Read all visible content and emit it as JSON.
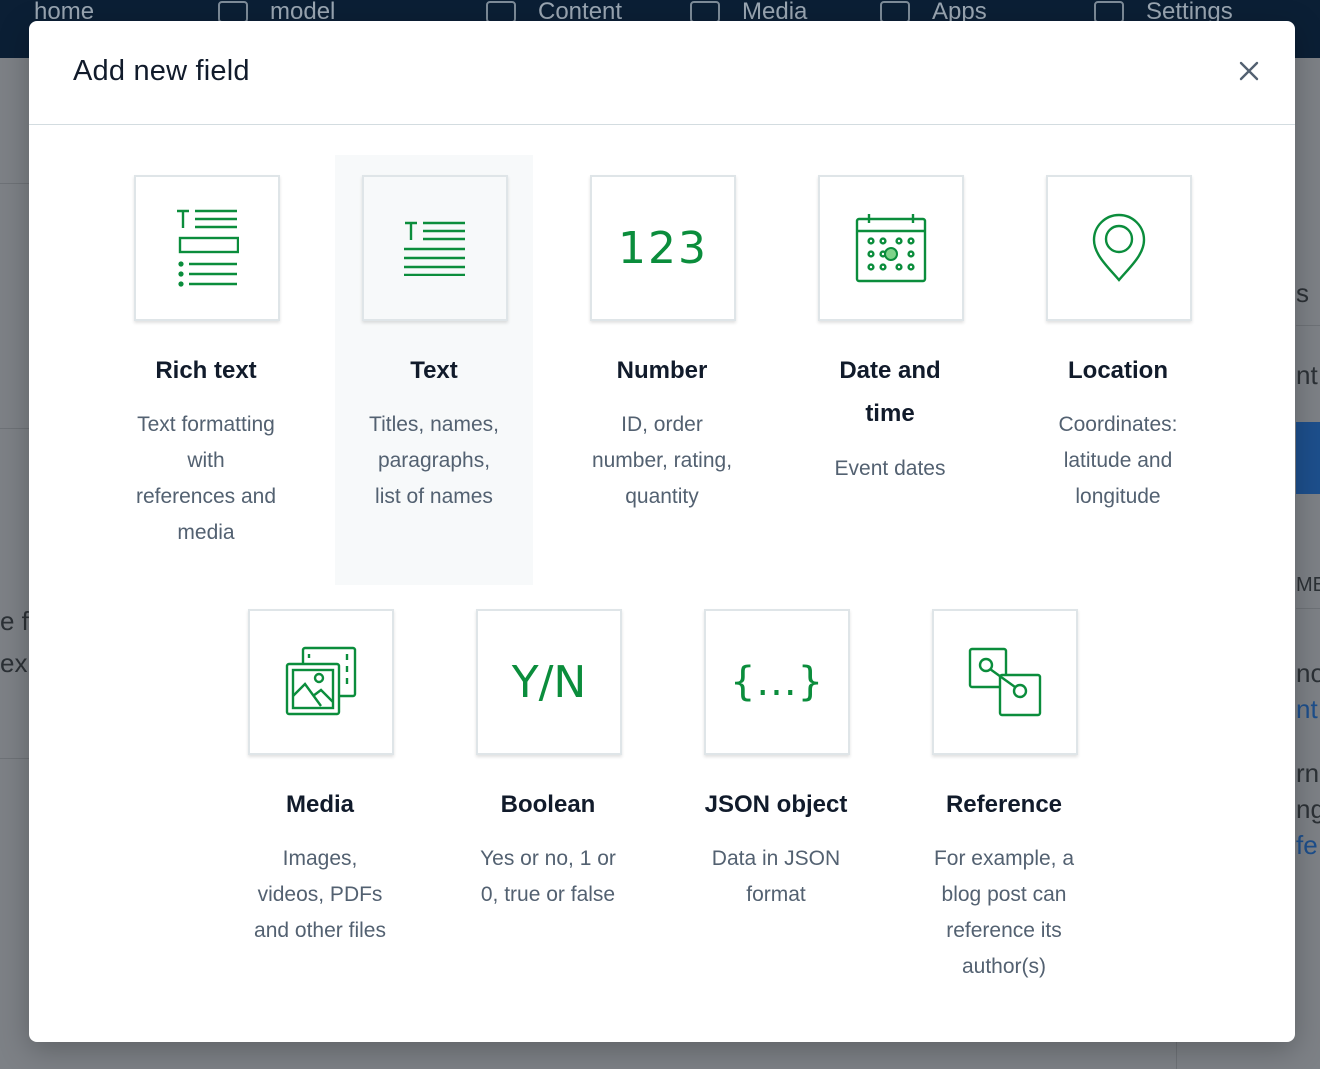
{
  "background": {
    "nav": [
      {
        "label": "home",
        "icon": "home-icon"
      },
      {
        "label": "model",
        "icon": "cube-icon"
      },
      {
        "label": "Content",
        "icon": "content-icon"
      },
      {
        "label": "Media",
        "icon": "media-icon"
      },
      {
        "label": "Apps",
        "icon": "puzzle-icon"
      },
      {
        "label": "Settings",
        "icon": "gear-icon"
      }
    ],
    "fragments": [
      "e fi",
      "ex",
      "s",
      "nt",
      "ME",
      "no",
      "nt",
      "rn",
      "ng",
      "fe"
    ]
  },
  "modal": {
    "title": "Add new field",
    "close_icon": "close-icon",
    "accent": "#0b8d3c",
    "fields": [
      {
        "title": "Rich text",
        "desc": [
          "Text formatting",
          "with",
          "references and",
          "media"
        ],
        "icon": "rich-text-icon"
      },
      {
        "title": "Text",
        "desc": [
          "Titles, names,",
          "paragraphs,",
          "list of names"
        ],
        "icon": "text-icon",
        "hovered": true
      },
      {
        "title": "Number",
        "desc": [
          "ID, order",
          "number, rating,",
          "quantity"
        ],
        "icon": "number-icon",
        "glyph": "123"
      },
      {
        "title": [
          "Date and",
          "time"
        ],
        "desc": [
          "Event dates"
        ],
        "icon": "calendar-icon"
      },
      {
        "title": "Location",
        "desc": [
          "Coordinates:",
          "latitude and",
          "longitude"
        ],
        "icon": "location-pin-icon"
      },
      {
        "title": "Media",
        "desc": [
          "Images,",
          "videos, PDFs",
          "and other files"
        ],
        "icon": "media-gallery-icon"
      },
      {
        "title": "Boolean",
        "desc": [
          "Yes or no, 1 or",
          "0, true or false"
        ],
        "icon": "boolean-icon",
        "glyph": "Y/N"
      },
      {
        "title": "JSON object",
        "desc": [
          "Data in JSON",
          "format"
        ],
        "icon": "json-icon",
        "glyph": "{...}"
      },
      {
        "title": "Reference",
        "desc": [
          "For example, a",
          "blog post can",
          "reference its",
          "author(s)"
        ],
        "icon": "reference-icon"
      }
    ]
  }
}
